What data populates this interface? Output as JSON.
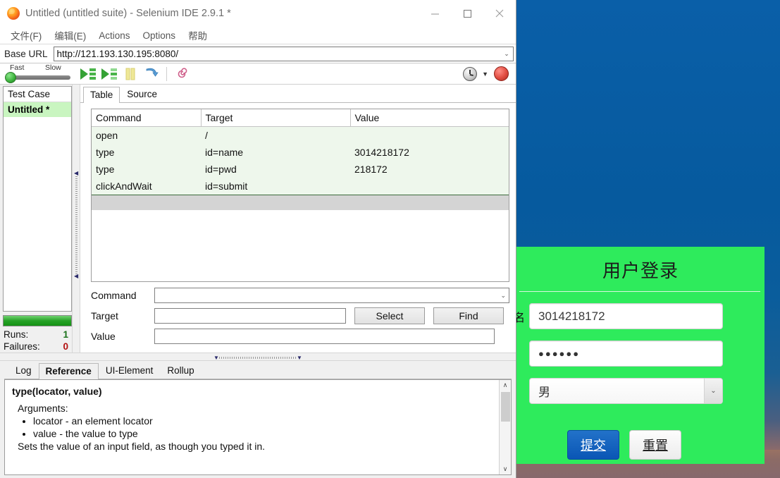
{
  "window": {
    "title": "Untitled (untitled suite) - Selenium IDE 2.9.1 *",
    "minimize": "—",
    "maximize": "☐",
    "close": "✕"
  },
  "menubar": {
    "items": [
      "文件(F)",
      "编辑(E)",
      "Actions",
      "Options",
      "帮助"
    ]
  },
  "urlbar": {
    "label": "Base URL",
    "value": "http://121.193.130.195:8080/",
    "arrow": "⌄"
  },
  "toolbar": {
    "speed_fast": "Fast",
    "speed_slow": "Slow",
    "caret": "▼"
  },
  "left_panel": {
    "header": "Test Case",
    "case_name": "Untitled *",
    "runs_label": "Runs:",
    "runs_value": "1",
    "failures_label": "Failures:",
    "failures_value": "0"
  },
  "editor": {
    "tabs": [
      {
        "label": "Table",
        "active": true
      },
      {
        "label": "Source",
        "active": false
      }
    ],
    "columns": [
      "Command",
      "Target",
      "Value"
    ],
    "rows": [
      {
        "command": "open",
        "target": "/",
        "value": ""
      },
      {
        "command": "type",
        "target": "id=name",
        "value": "3014218172"
      },
      {
        "command": "type",
        "target": "id=pwd",
        "value": "218172"
      },
      {
        "command": "clickAndWait",
        "target": "id=submit",
        "value": ""
      }
    ]
  },
  "cmd_form": {
    "command_label": "Command",
    "command_value": "",
    "target_label": "Target",
    "target_value": "",
    "value_label": "Value",
    "value_value": "",
    "select_button": "Select",
    "find_button": "Find",
    "combo_arrow": "⌄"
  },
  "bottom_panel": {
    "tabs": [
      {
        "label": "Log",
        "active": false
      },
      {
        "label": "Reference",
        "active": true
      },
      {
        "label": "UI-Element",
        "active": false
      },
      {
        "label": "Rollup",
        "active": false
      }
    ],
    "reference": {
      "signature": "type(locator, value)",
      "arguments_label": "Arguments:",
      "arguments": [
        "locator - an element locator",
        "value - the value to type"
      ],
      "description": "Sets the value of an input field, as though you typed it in."
    },
    "scroll_up": "∧",
    "scroll_down": "∨"
  },
  "login_page": {
    "title": "用户登录",
    "username_label": "名",
    "username_value": "3014218172",
    "password_value": "●●●●●●",
    "gender_value": "男",
    "gender_arrow": "⌄",
    "submit_button": "提交",
    "reset_button": "重置"
  },
  "colors": {
    "form_green": "#2eeb5c",
    "submit_blue": "#0a56b5",
    "desktop_blue": "#065a9e",
    "row_green": "#eef7ec",
    "selected_green": "#c9f5c0",
    "runs_green": "#197019",
    "fail_red": "#b31111"
  }
}
